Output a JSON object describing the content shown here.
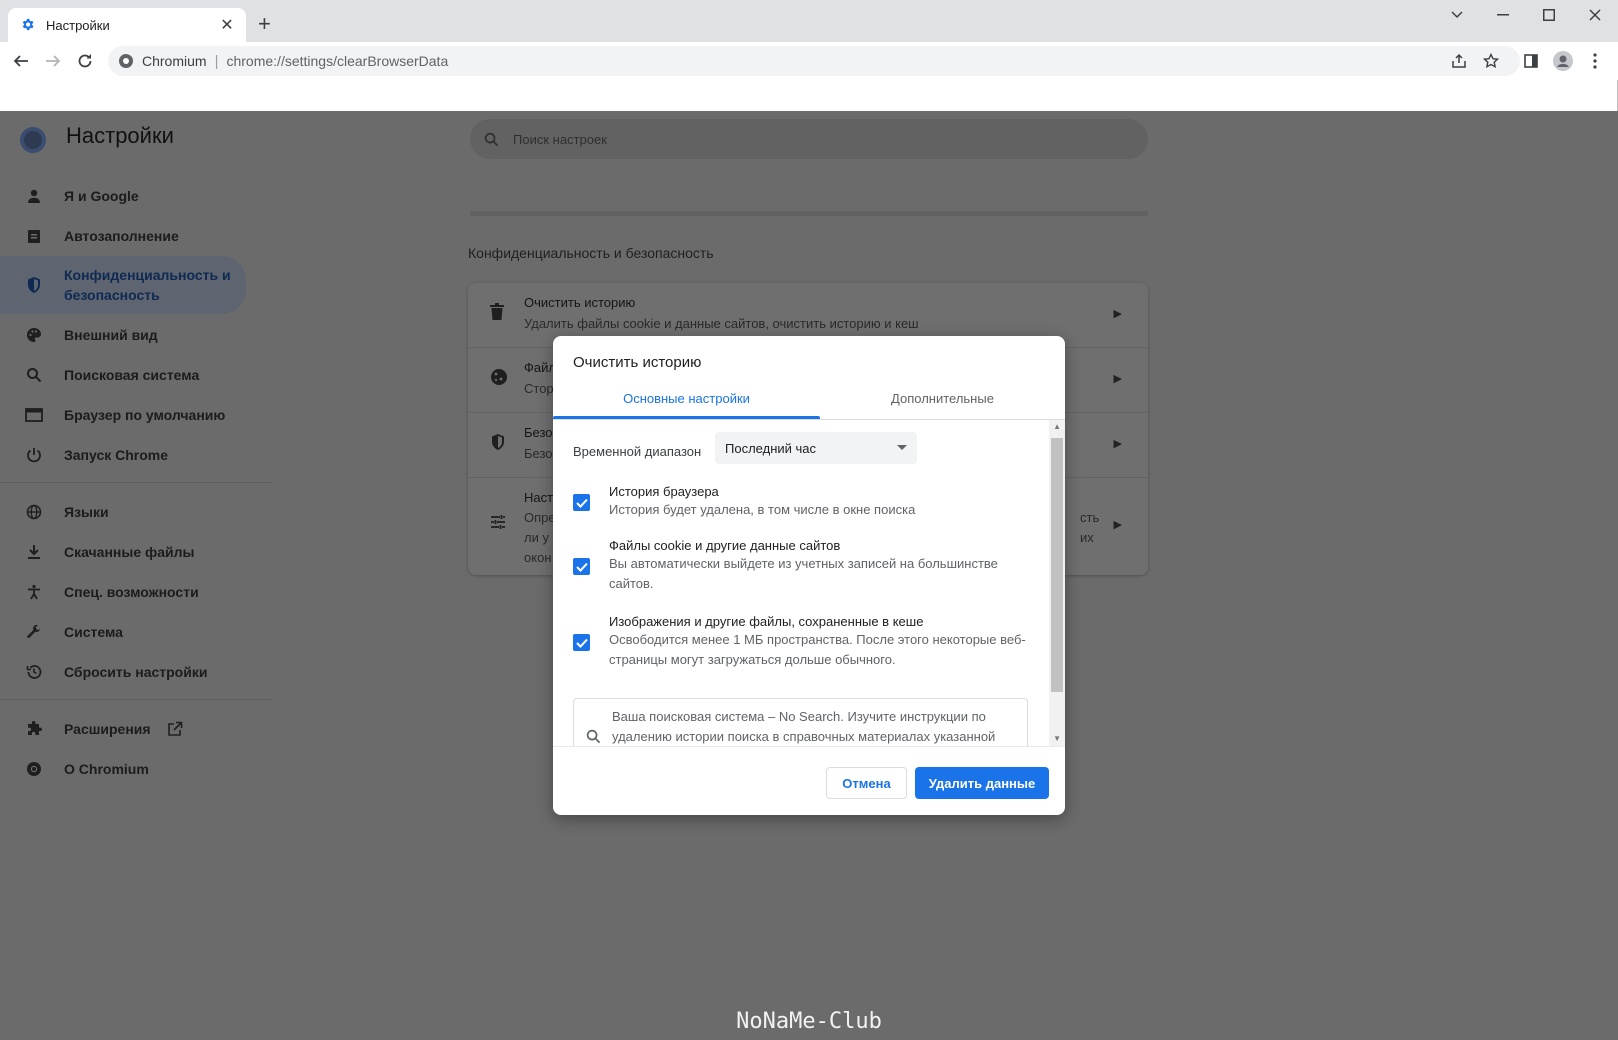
{
  "browser": {
    "tab_title": "Настройки",
    "site_name": "Chromium",
    "url": "chrome://settings/clearBrowserData"
  },
  "settings": {
    "title": "Настройки",
    "search_placeholder": "Поиск настроек",
    "nav": [
      {
        "label": "Я и Google",
        "icon": "person-icon"
      },
      {
        "label": "Автозаполнение",
        "icon": "clipboard-icon"
      },
      {
        "label": "Конфиденциальность и безопасность",
        "label_line1": "Конфиденциальность и",
        "label_line2": "безопасность",
        "icon": "shield-icon",
        "active": true
      },
      {
        "label": "Внешний вид",
        "icon": "palette-icon"
      },
      {
        "label": "Поисковая система",
        "icon": "search-icon"
      },
      {
        "label": "Браузер по умолчанию",
        "icon": "browser-icon"
      },
      {
        "label": "Запуск Chrome",
        "icon": "power-icon"
      },
      {
        "label": "Языки",
        "icon": "globe-icon"
      },
      {
        "label": "Скачанные файлы",
        "icon": "download-icon"
      },
      {
        "label": "Спец. возможности",
        "icon": "accessibility-icon"
      },
      {
        "label": "Система",
        "icon": "wrench-icon"
      },
      {
        "label": "Сбросить настройки",
        "icon": "history-icon"
      },
      {
        "label": "Расширения",
        "icon": "puzzle-icon"
      },
      {
        "label": "О Chromium",
        "icon": "chromium-icon"
      }
    ],
    "section_title": "Конфиденциальность и безопасность",
    "rows": [
      {
        "title": "Очистить историю",
        "desc": "Удалить файлы cookie и данные сайтов, очистить историю и кеш"
      },
      {
        "title": "Файл",
        "desc": "Стор"
      },
      {
        "title": "Безо",
        "desc": "Безо"
      },
      {
        "title": "Наст",
        "desc": "Опре",
        "desc2": "ли у",
        "desc3": "окон",
        "right1": "сть",
        "right2": "их"
      }
    ]
  },
  "dialog": {
    "title": "Очистить историю",
    "tabs": [
      "Основные настройки",
      "Дополнительные"
    ],
    "range_label": "Временной диапазон",
    "range_value": "Последний час",
    "items": [
      {
        "title": "История браузера",
        "desc": "История будет удалена, в том числе в окне поиска",
        "checked": true
      },
      {
        "title": "Файлы cookie и другие данные сайтов",
        "desc": "Вы автоматически выйдете из учетных записей на большинстве сайтов.",
        "checked": true
      },
      {
        "title": "Изображения и другие файлы, сохраненные в кеше",
        "desc": "Освободится менее 1 МБ пространства. После этого некоторые веб-страницы могут загружаться дольше обычного.",
        "checked": true
      }
    ],
    "notice": "Ваша поисковая система – No Search. Изучите инструкции по удалению истории поиска в справочных материалах указанной",
    "cancel": "Отмена",
    "delete": "Удалить данные"
  },
  "watermark": "NoNaMe-Club",
  "colors": {
    "accent": "#1a73e8",
    "overlay": "#6b6b6b"
  }
}
